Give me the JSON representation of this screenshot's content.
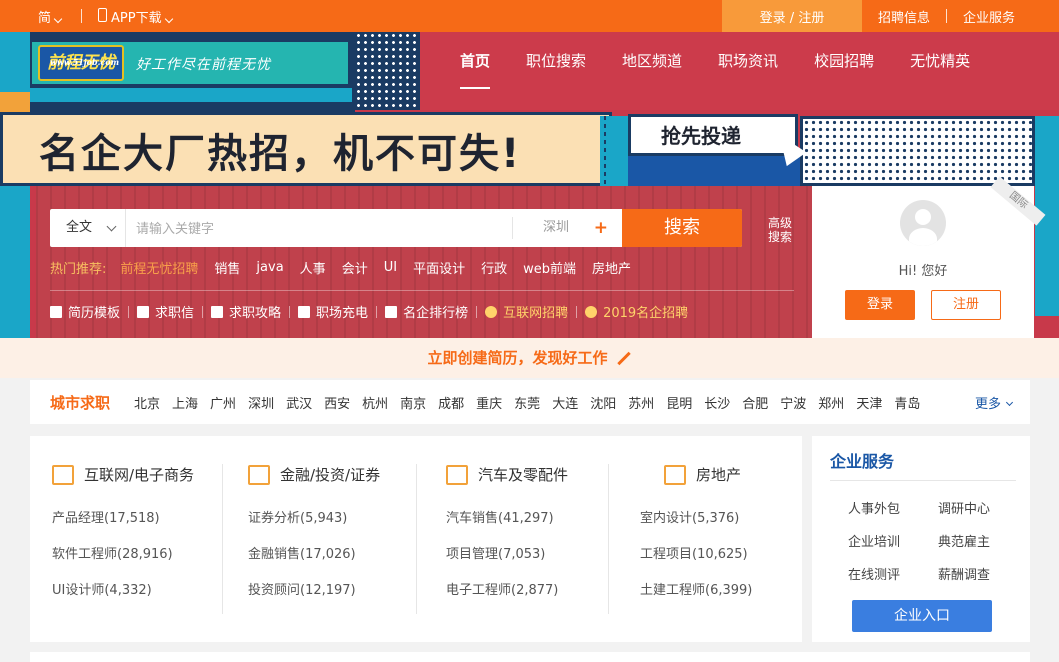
{
  "topbar": {
    "lang": "简",
    "app_download": "APP下载",
    "login_register": "登录 / 注册",
    "links": [
      "招聘信息",
      "企业服务"
    ]
  },
  "brand": {
    "logo_url": "www.51job.com",
    "logo_text": "前程无忧",
    "slogan": "好工作尽在前程无忧"
  },
  "nav": {
    "items": [
      {
        "label": "首页",
        "active": true
      },
      {
        "label": "职位搜索"
      },
      {
        "label": "地区频道"
      },
      {
        "label": "职场资讯"
      },
      {
        "label": "校园招聘"
      },
      {
        "label": "无忧精英"
      }
    ]
  },
  "banner": {
    "headline": "名企大厂热招，机不可失!",
    "cta": "抢先投递"
  },
  "search": {
    "scope": "全文",
    "placeholder": "请输入关键字",
    "city": "深圳",
    "button": "搜索",
    "advanced": "高级搜索",
    "hot_label": "热门推荐:",
    "hot_items": [
      "前程无忧招聘",
      "销售",
      "java",
      "人事",
      "会计",
      "UI",
      "平面设计",
      "行政",
      "web前端",
      "房地产"
    ],
    "links": [
      {
        "label": "简历模板"
      },
      {
        "label": "求职信"
      },
      {
        "label": "求职攻略"
      },
      {
        "label": "职场充电"
      },
      {
        "label": "名企排行榜"
      },
      {
        "label": "互联网招聘"
      },
      {
        "label": "2019名企招聘"
      }
    ]
  },
  "login_card": {
    "greeting": "Hi! 您好",
    "login": "登录",
    "register": "注册",
    "corner_tag": "国际"
  },
  "resume_strip": "立即创建简历，发现好工作",
  "cities": {
    "title": "城市求职",
    "list": [
      "北京",
      "上海",
      "广州",
      "深圳",
      "武汉",
      "西安",
      "杭州",
      "南京",
      "成都",
      "重庆",
      "东莞",
      "大连",
      "沈阳",
      "苏州",
      "昆明",
      "长沙",
      "合肥",
      "宁波",
      "郑州",
      "天津",
      "青岛"
    ],
    "more": "更多"
  },
  "categories": [
    {
      "title": "互联网/电子商务",
      "jobs": [
        "产品经理(17,518)",
        "软件工程师(28,916)",
        "UI设计师(4,332)"
      ]
    },
    {
      "title": "金融/投资/证券",
      "jobs": [
        "证券分析(5,943)",
        "金融销售(17,026)",
        "投资顾问(12,197)"
      ]
    },
    {
      "title": "汽车及零配件",
      "jobs": [
        "汽车销售(41,297)",
        "项目管理(7,053)",
        "电子工程师(2,877)"
      ]
    },
    {
      "title": "房地产",
      "jobs": [
        "室内设计(5,376)",
        "工程项目(10,625)",
        "土建工程师(6,399)"
      ]
    }
  ],
  "enterprise": {
    "title": "企业服务",
    "items": [
      "人事外包",
      "调研中心",
      "企业培训",
      "典范雇主",
      "在线测评",
      "薪酬调查"
    ],
    "button": "企业入口"
  }
}
